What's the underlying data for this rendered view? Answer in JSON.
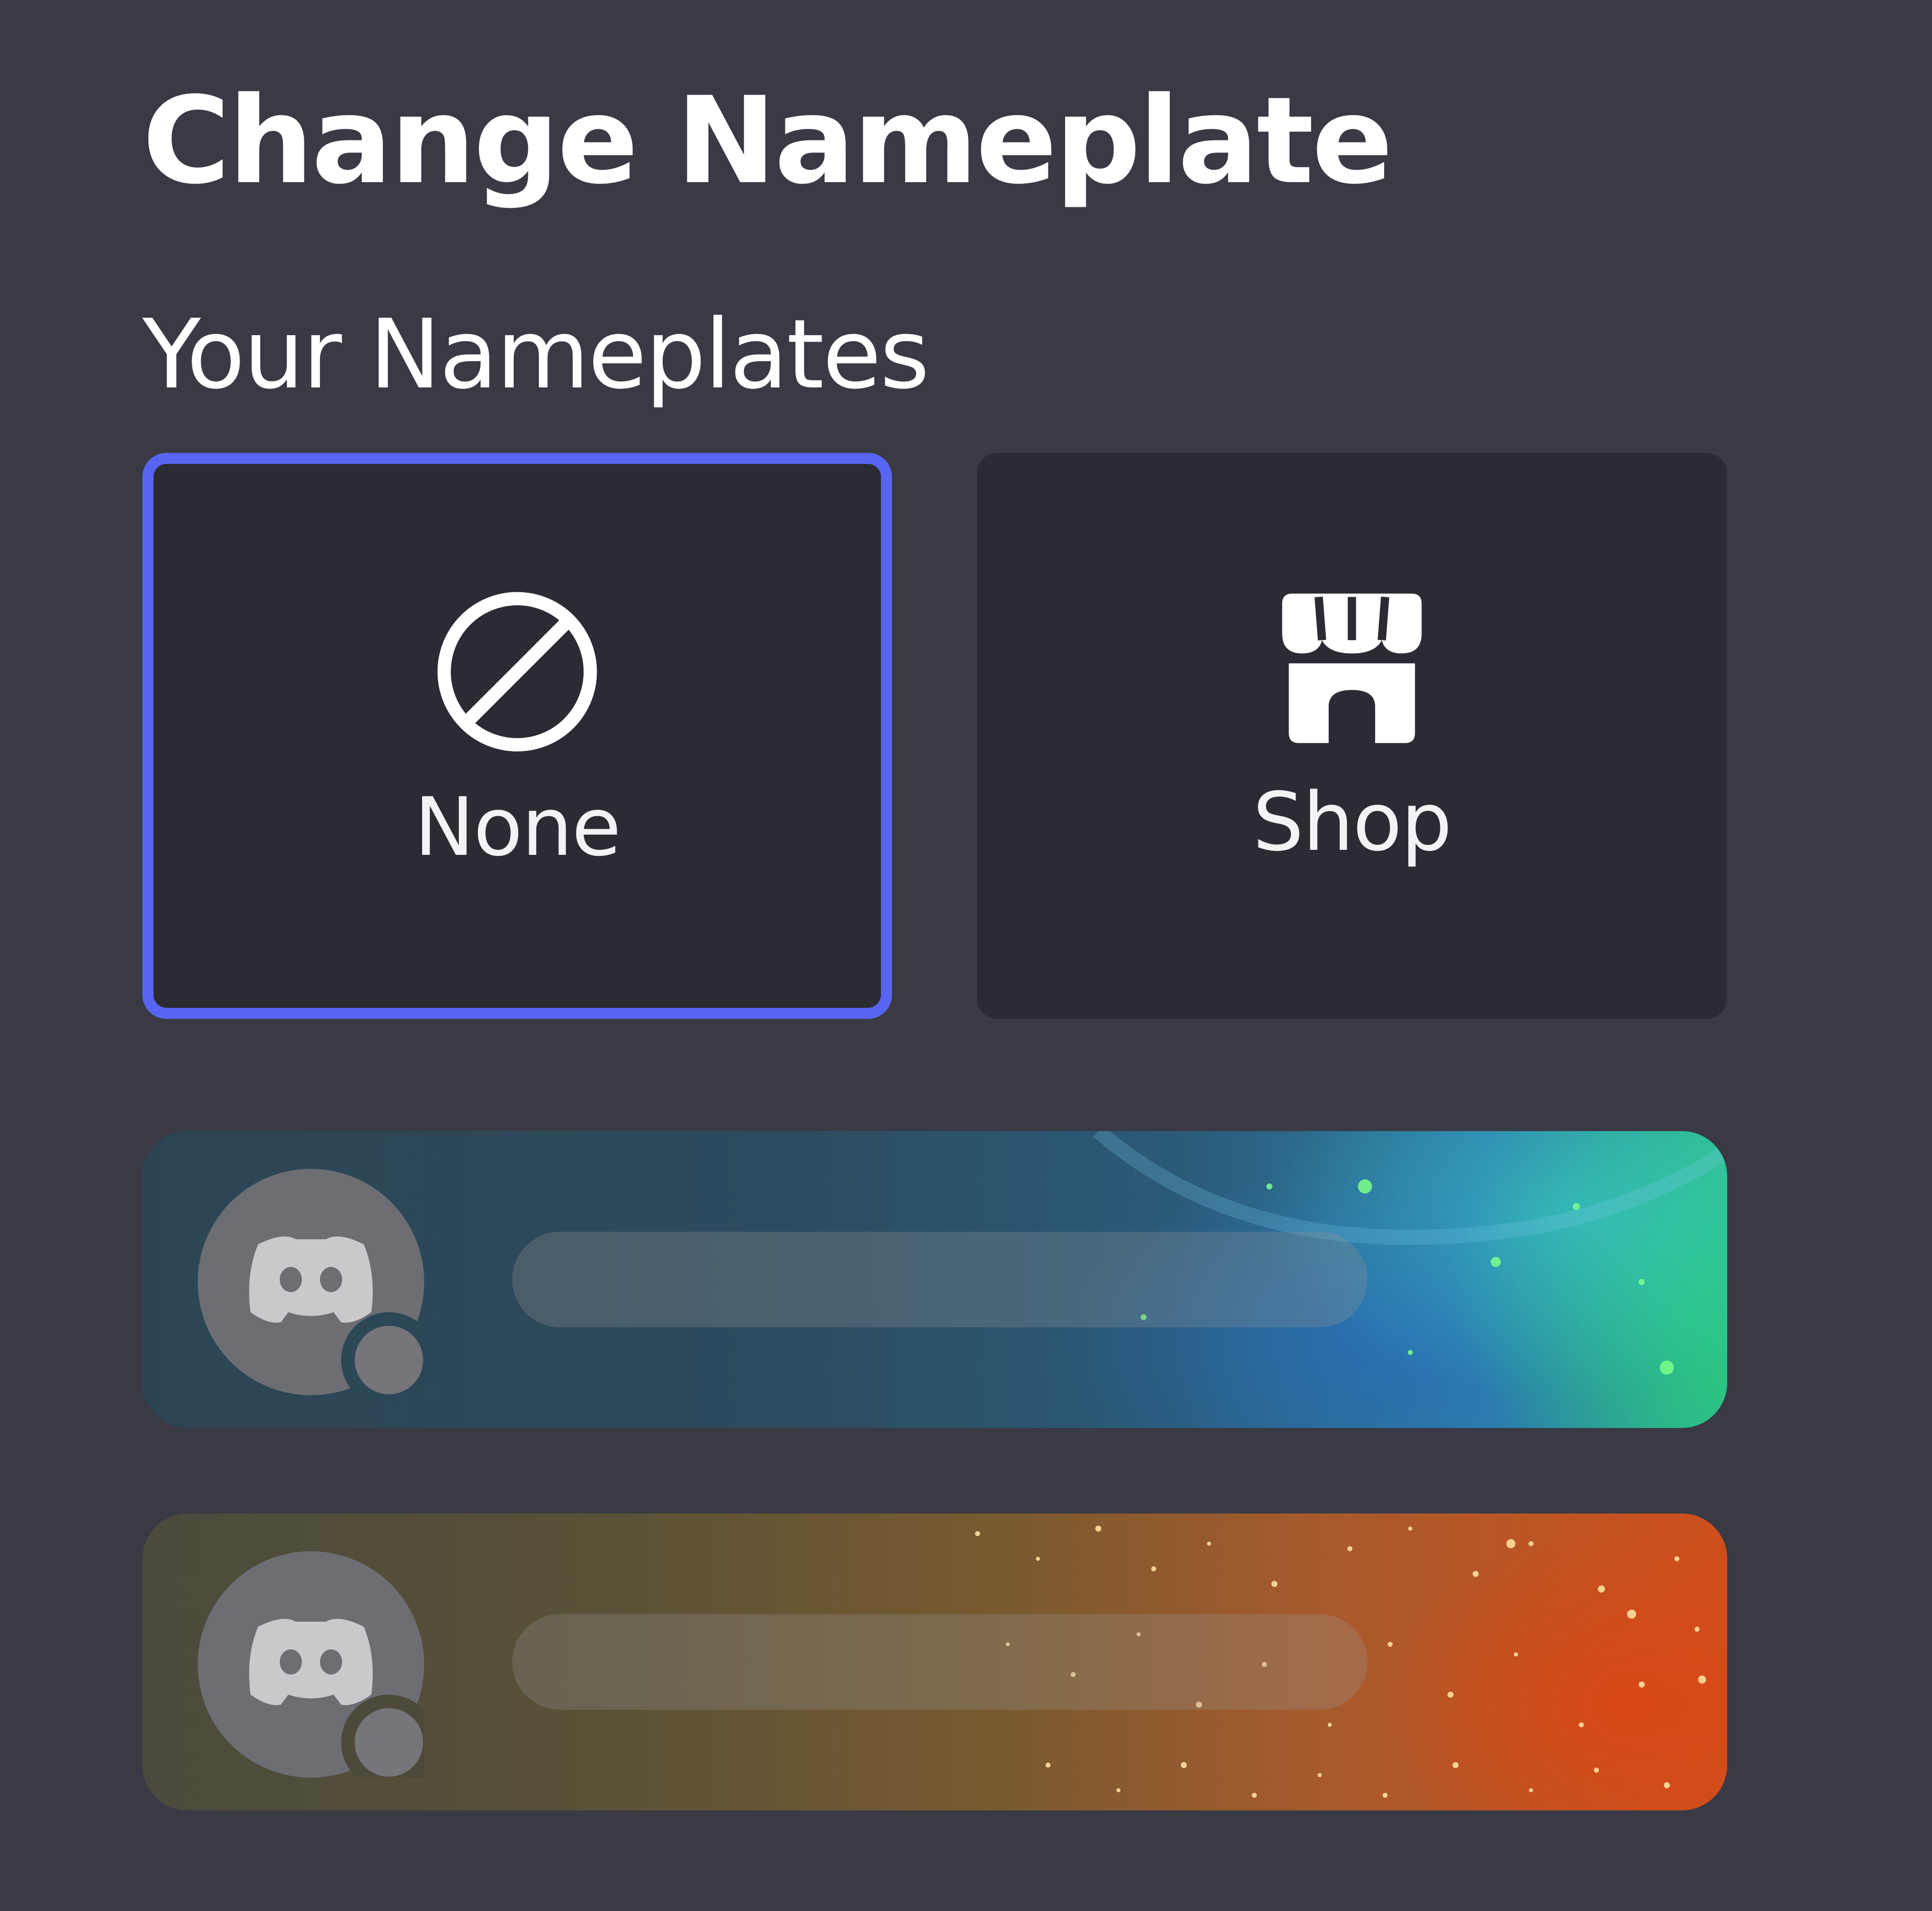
{
  "header": {
    "title": "Change Nameplate"
  },
  "section": {
    "label": "Your Nameplates"
  },
  "tiles": [
    {
      "label": "None",
      "icon": "none-icon",
      "selected": true
    },
    {
      "label": "Shop",
      "icon": "shop-icon",
      "selected": false
    }
  ],
  "nameplates": [
    {
      "icon": "discord-avatar-icon",
      "theme": "teal-green-galaxy"
    },
    {
      "icon": "discord-avatar-icon",
      "theme": "orange-ember-sparkle"
    }
  ],
  "colors": {
    "background": "#393a44",
    "tile_background": "#2b2c33",
    "selected_border": "#5865f2",
    "text": "#ffffff"
  }
}
